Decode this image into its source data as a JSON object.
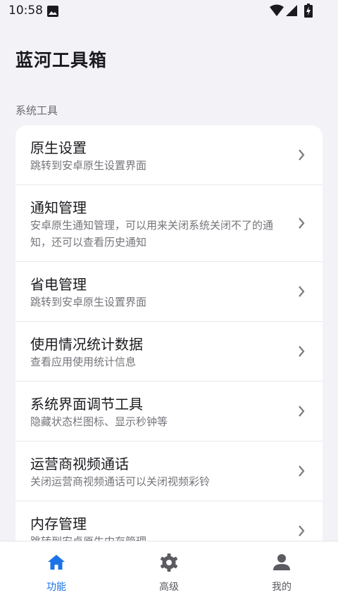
{
  "status_bar": {
    "time": "10:58"
  },
  "header": {
    "title": "蓝河工具箱"
  },
  "section": {
    "label": "系统工具"
  },
  "items": [
    {
      "title": "原生设置",
      "desc": "跳转到安卓原生设置界面"
    },
    {
      "title": "通知管理",
      "desc": "安卓原生通知管理，可以用来关闭系统关闭不了的通知，还可以查看历史通知"
    },
    {
      "title": "省电管理",
      "desc": "跳转到安卓原生设置界面"
    },
    {
      "title": "使用情况统计数据",
      "desc": "查看应用使用统计信息"
    },
    {
      "title": "系统界面调节工具",
      "desc": "隐藏状态栏图标、显示秒钟等"
    },
    {
      "title": "运营商视频通话",
      "desc": "关闭运营商视频通话可以关闭视频彩铃"
    },
    {
      "title": "内存管理",
      "desc": "跳转到安卓原生内存管理"
    }
  ],
  "bottom_nav": [
    {
      "label": "功能",
      "icon": "home-icon",
      "active": true
    },
    {
      "label": "高级",
      "icon": "gear-icon",
      "active": false
    },
    {
      "label": "我的",
      "icon": "person-icon",
      "active": false
    }
  ],
  "colors": {
    "accent": "#1a73e8",
    "background": "#f3f2f7",
    "card": "#ffffff"
  }
}
